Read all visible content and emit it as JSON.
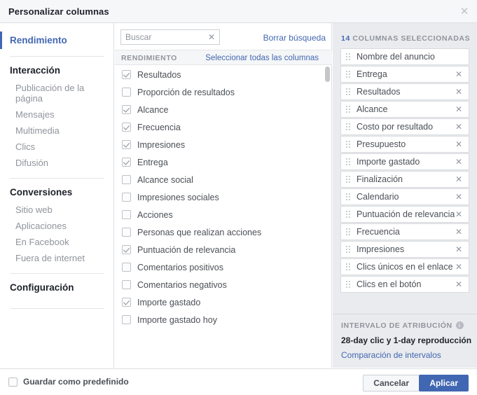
{
  "dialog": {
    "title": "Personalizar columnas",
    "close_icon": "close-icon"
  },
  "sidebar": {
    "active_item": "Rendimiento",
    "groups": [
      {
        "title": "Interacción",
        "items": [
          "Publicación de la página",
          "Mensajes",
          "Multimedia",
          "Clics",
          "Difusión"
        ]
      },
      {
        "title": "Conversiones",
        "items": [
          "Sitio web",
          "Aplicaciones",
          "En Facebook",
          "Fuera de internet"
        ]
      },
      {
        "title": "Configuración",
        "items": []
      }
    ]
  },
  "search": {
    "value": "",
    "placeholder": "Buscar",
    "clear_icon": "clear-icon",
    "clear_link": "Borrar búsqueda"
  },
  "middle": {
    "section_label": "RENDIMIENTO",
    "select_all_link": "Seleccionar todas las columnas",
    "options": [
      {
        "label": "Resultados",
        "checked": true
      },
      {
        "label": "Proporción de resultados",
        "checked": false
      },
      {
        "label": "Alcance",
        "checked": true
      },
      {
        "label": "Frecuencia",
        "checked": true
      },
      {
        "label": "Impresiones",
        "checked": true
      },
      {
        "label": "Entrega",
        "checked": true
      },
      {
        "label": "Alcance social",
        "checked": false
      },
      {
        "label": "Impresiones sociales",
        "checked": false
      },
      {
        "label": "Acciones",
        "checked": false
      },
      {
        "label": "Personas que realizan acciones",
        "checked": false
      },
      {
        "label": "Puntuación de relevancia",
        "checked": true
      },
      {
        "label": "Comentarios positivos",
        "checked": false
      },
      {
        "label": "Comentarios negativos",
        "checked": false
      },
      {
        "label": "Importe gastado",
        "checked": true
      },
      {
        "label": "Importe gastado hoy",
        "checked": false
      }
    ]
  },
  "selected_panel": {
    "count": "14",
    "header_label": "COLUMNAS SELECCIONADAS",
    "items": [
      {
        "label": "Nombre del anuncio",
        "removable": false
      },
      {
        "label": "Entrega",
        "removable": true
      },
      {
        "label": "Resultados",
        "removable": true
      },
      {
        "label": "Alcance",
        "removable": true
      },
      {
        "label": "Costo por resultado",
        "removable": true
      },
      {
        "label": "Presupuesto",
        "removable": true
      },
      {
        "label": "Importe gastado",
        "removable": true
      },
      {
        "label": "Finalización",
        "removable": true
      },
      {
        "label": "Calendario",
        "removable": true
      },
      {
        "label": "Puntuación de relevancia",
        "removable": true
      },
      {
        "label": "Frecuencia",
        "removable": true
      },
      {
        "label": "Impresiones",
        "removable": true
      },
      {
        "label": "Clics únicos en el enlace",
        "removable": true
      },
      {
        "label": "Clics en el botón",
        "removable": true
      }
    ]
  },
  "attribution": {
    "header": "INTERVALO DE ATRIBUCIÓN",
    "info_icon": "info-icon",
    "value": "28-day clic y 1-day reproducción",
    "link": "Comparación de intervalos"
  },
  "footer": {
    "save_preset_label": "Guardar como predefinido",
    "save_preset_checked": false,
    "cancel_label": "Cancelar",
    "apply_label": "Aplicar"
  },
  "colors": {
    "brand": "#4267b2",
    "panel_bg": "#e9ebee",
    "header_bg": "#f6f7f9",
    "text": "#4b4f56",
    "muted": "#90949c"
  }
}
